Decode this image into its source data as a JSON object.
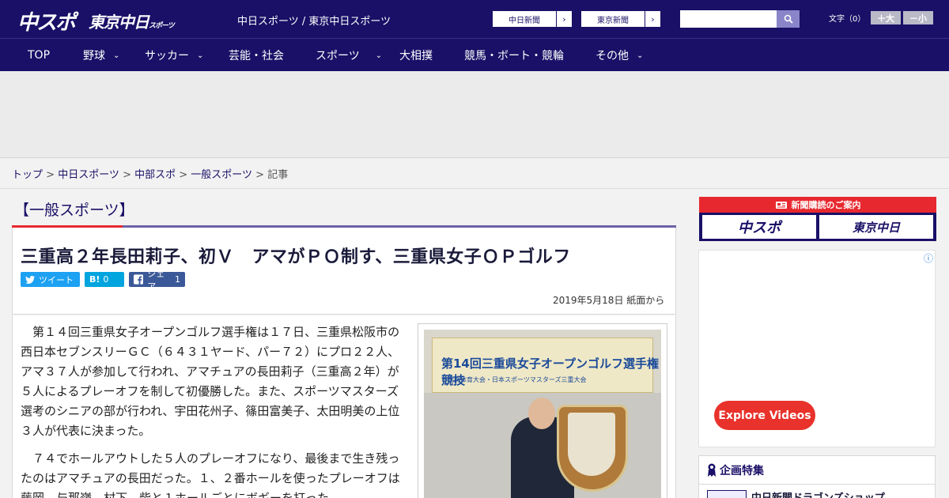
{
  "header": {
    "logo_main": "中スポ",
    "logo_tokyo": "東京中日",
    "logo_tokyo_small": "スポーツ",
    "site_title": "中日スポーツ / 東京中日スポーツ",
    "ext_links": [
      {
        "label": "中日新聞",
        "arrow": "›"
      },
      {
        "label": "東京新聞",
        "arrow": "›"
      }
    ],
    "search_placeholder": "",
    "font_label": "文字（0）",
    "font_larger": "＋大",
    "font_smaller": "－小"
  },
  "nav": {
    "items": [
      {
        "label": "TOP",
        "has_menu": false
      },
      {
        "label": "野球",
        "has_menu": true
      },
      {
        "label": "サッカー",
        "has_menu": true
      },
      {
        "label": "芸能・社会",
        "has_menu": false
      },
      {
        "label": "スポーツ",
        "has_menu": true
      },
      {
        "label": "大相撲",
        "has_menu": false
      },
      {
        "label": "競馬・ボート・競輪",
        "has_menu": false
      },
      {
        "label": "その他",
        "has_menu": true
      }
    ],
    "chevron": "⌄"
  },
  "breadcrumb": {
    "items": [
      "トップ",
      "中日スポーツ",
      "中部スポ",
      "一般スポーツ"
    ],
    "current": "記事",
    "separator": " > "
  },
  "article": {
    "category": "【一般スポーツ】",
    "headline": "三重高２年長田莉子、初Ｖ　アマがＰＯ制す、三重県女子ＯＰゴルフ",
    "share": {
      "tweet": "ツイート",
      "hatena_icon": "B!",
      "hatena_count": "0",
      "facebook_label": "シェア",
      "facebook_count": "1"
    },
    "dateline": "2019年5月18日 紙面から",
    "paragraphs": [
      "　第１４回三重県女子オープンゴルフ選手権は１７日、三重県松阪市の西日本セブンスリーＧＣ（６４３１ヤード、パー７２）にプロ２２人、アマ３７人が参加して行われ、アマチュアの長田莉子（三重高２年）が５人によるプレーオフを制して初優勝した。また、スポーツマスターズ選考のシニアの部が行われ、宇田花州子、篠田富美子、太田明美の上位３人が代表に決まった。",
      "　７４でホールアウトした５人のプレーオフになり、最後まで生き残ったのはアマチュアの長田だった。１、２番ホールを使ったプレーオフは藤岡、与那嶺、村下、柴と１ホールごとにボギーを打った"
    ],
    "photo_banner": "第14回三重県女子オープンゴルフ選手権競技",
    "photo_banner_sub": "国民体育大会・日本スポーツマスターズ三重大会"
  },
  "sidebar": {
    "promo_top": "新聞購読のご案内",
    "promo_left": "中スポ",
    "promo_right": "東京中日",
    "ad_cta": "Explore Videos",
    "info_icon": "ⓘ",
    "kikaku_title": "企画特集",
    "kikaku_item": "中日新聞ドラゴンズショップ"
  },
  "colors": {
    "brand_navy": "#1a1067",
    "accent_red": "#e7282e",
    "twitter": "#1da1f2",
    "hatena": "#00a4de",
    "facebook": "#3b5998"
  }
}
